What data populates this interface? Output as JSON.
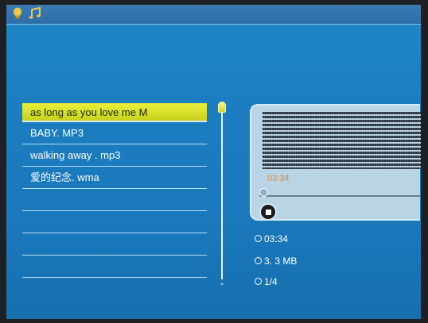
{
  "playlist": {
    "items": [
      {
        "label": "as long as you love me M",
        "selected": true
      },
      {
        "label": "BABY. MP3",
        "selected": false
      },
      {
        "label": "walking away . mp3",
        "selected": false
      },
      {
        "label": "爱的纪念. wma",
        "selected": false
      },
      {
        "label": "",
        "selected": false
      },
      {
        "label": "",
        "selected": false
      },
      {
        "label": "",
        "selected": false
      },
      {
        "label": "",
        "selected": false
      }
    ]
  },
  "player": {
    "time_display": "03:34",
    "progress_fraction": 0.0
  },
  "info": {
    "duration": "03:34",
    "size": "3. 3 MB",
    "track": "1/4"
  },
  "icons": {
    "top_left": [
      "bulb-icon",
      "music-note-icon"
    ],
    "stop": "stop-icon",
    "scroll_down": "chevron-down-icon"
  },
  "colors": {
    "screen_blue": "#1a78bb",
    "selected_highlight": "#d9e22a",
    "time_orange": "#e48a3c"
  }
}
